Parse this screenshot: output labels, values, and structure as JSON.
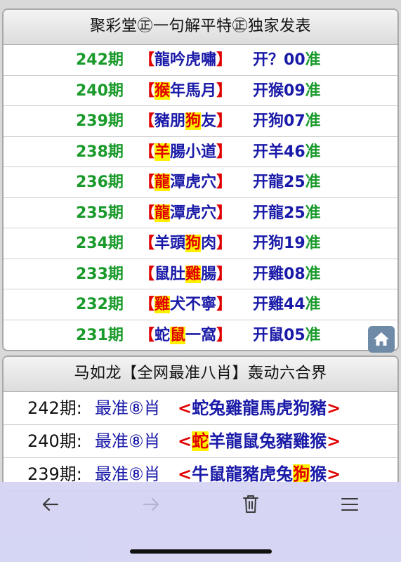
{
  "panel1": {
    "title": "聚彩堂㊣一句解平特㊣独家发表",
    "rows": [
      {
        "period": "242期",
        "open": "【",
        "p": [
          "龍",
          "吟",
          "虎",
          "嘯"
        ],
        "hl": -1,
        "close": "】",
        "result_a": "开",
        "result_b": "？00",
        "zhun": "准"
      },
      {
        "period": "240期",
        "open": "【",
        "p": [
          "猴",
          "年",
          "馬",
          "月"
        ],
        "hl": 0,
        "close": "】",
        "result_a": "开",
        "result_b": "猴09",
        "zhun": "准"
      },
      {
        "period": "239期",
        "open": "【",
        "p": [
          "豬",
          "朋",
          "狗",
          "友"
        ],
        "hl": 2,
        "close": "】",
        "result_a": "开",
        "result_b": "狗07",
        "zhun": "准"
      },
      {
        "period": "238期",
        "open": "【",
        "p": [
          "羊",
          "腸",
          "小",
          "道"
        ],
        "hl": 0,
        "close": "】",
        "result_a": "开",
        "result_b": "羊46",
        "zhun": "准"
      },
      {
        "period": "236期",
        "open": "【",
        "p": [
          "龍",
          "潭",
          "虎",
          "穴"
        ],
        "hl": 0,
        "close": "】",
        "result_a": "开",
        "result_b": "龍25",
        "zhun": "准"
      },
      {
        "period": "235期",
        "open": "【",
        "p": [
          "龍",
          "潭",
          "虎",
          "穴"
        ],
        "hl": 0,
        "close": "】",
        "result_a": "开",
        "result_b": "龍25",
        "zhun": "准"
      },
      {
        "period": "234期",
        "open": "【",
        "p": [
          "羊",
          "頭",
          "狗",
          "肉"
        ],
        "hl": 2,
        "close": "】",
        "result_a": "开",
        "result_b": "狗19",
        "zhun": "准"
      },
      {
        "period": "233期",
        "open": "【",
        "p": [
          "鼠",
          "肚",
          "雞",
          "腸"
        ],
        "hl": 2,
        "close": "】",
        "result_a": "开",
        "result_b": "雞08",
        "zhun": "准"
      },
      {
        "period": "232期",
        "open": "【",
        "p": [
          "雞",
          "犬",
          "不",
          "寧"
        ],
        "hl": 0,
        "close": "】",
        "result_a": "开",
        "result_b": "雞44",
        "zhun": "准"
      },
      {
        "period": "231期",
        "open": "【",
        "p": [
          "蛇",
          "鼠",
          "一",
          "窩"
        ],
        "hl": 1,
        "close": "】",
        "result_a": "开",
        "result_b": "鼠05",
        "zhun": "准"
      }
    ]
  },
  "panel2": {
    "title": "马如龙【全网最准八肖】轰动六合界",
    "rows": [
      {
        "period": "242期:",
        "label": "最准⑧肖",
        "open": "<",
        "z": [
          "蛇",
          "兔",
          "雞",
          "龍",
          "馬",
          "虎",
          "狗",
          "豬"
        ],
        "hl": -1,
        "close": ">"
      },
      {
        "period": "240期:",
        "label": "最准⑧肖",
        "open": "<",
        "z": [
          "蛇",
          "羊",
          "龍",
          "鼠",
          "兔",
          "豬",
          "雞",
          "猴"
        ],
        "hl": 0,
        "close": ">"
      },
      {
        "period": "239期:",
        "label": "最准⑧肖",
        "open": "<",
        "z": [
          "牛",
          "鼠",
          "龍",
          "豬",
          "虎",
          "兔",
          "狗",
          "猴"
        ],
        "hl": 6,
        "close": ">"
      }
    ]
  },
  "icons": {
    "home": "home-icon",
    "back": "arrow-left-icon",
    "forward": "arrow-right-icon",
    "trash": "trash-icon",
    "menu": "menu-icon"
  },
  "colors": {
    "period_green": "#1a9a2b",
    "bracket_red": "#e00000",
    "text_blue": "#1a1aa8",
    "highlight_yellow": "#fff000"
  }
}
